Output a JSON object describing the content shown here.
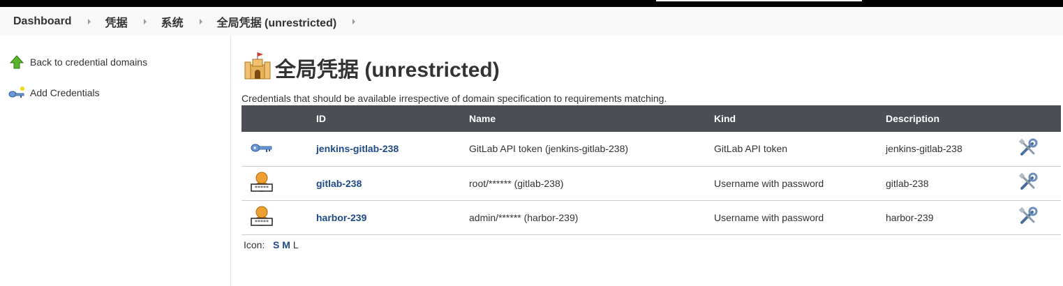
{
  "breadcrumb": {
    "items": [
      {
        "label": "Dashboard"
      },
      {
        "label": "凭据"
      },
      {
        "label": "系统"
      },
      {
        "label": "全局凭据 (unrestricted)"
      }
    ]
  },
  "sidebar": {
    "items": [
      {
        "label": "Back to credential domains",
        "icon": "green-up-arrow-icon"
      },
      {
        "label": "Add Credentials",
        "icon": "key-add-icon"
      }
    ]
  },
  "page": {
    "title": "全局凭据 (unrestricted)",
    "description": "Credentials that should be available irrespective of domain specification to requirements matching."
  },
  "table": {
    "headers": {
      "id": "ID",
      "name": "Name",
      "kind": "Kind",
      "description": "Description"
    },
    "rows": [
      {
        "icon": "key-icon",
        "id": "jenkins-gitlab-238",
        "name": "GitLab API token (jenkins-gitlab-238)",
        "kind": "GitLab API token",
        "description": "jenkins-gitlab-238"
      },
      {
        "icon": "user-password-icon",
        "id": "gitlab-238",
        "name": "root/****** (gitlab-238)",
        "kind": "Username with password",
        "description": "gitlab-238"
      },
      {
        "icon": "user-password-icon",
        "id": "harbor-239",
        "name": "admin/****** (harbor-239)",
        "kind": "Username with password",
        "description": "harbor-239"
      }
    ]
  },
  "icon_size": {
    "label": "Icon:",
    "options": [
      "S",
      "M",
      "L"
    ],
    "selected": "L"
  },
  "colors": {
    "header_bg": "#4b4f55",
    "link": "#204a87",
    "breadcrumb_bg": "#f8f8f8"
  }
}
